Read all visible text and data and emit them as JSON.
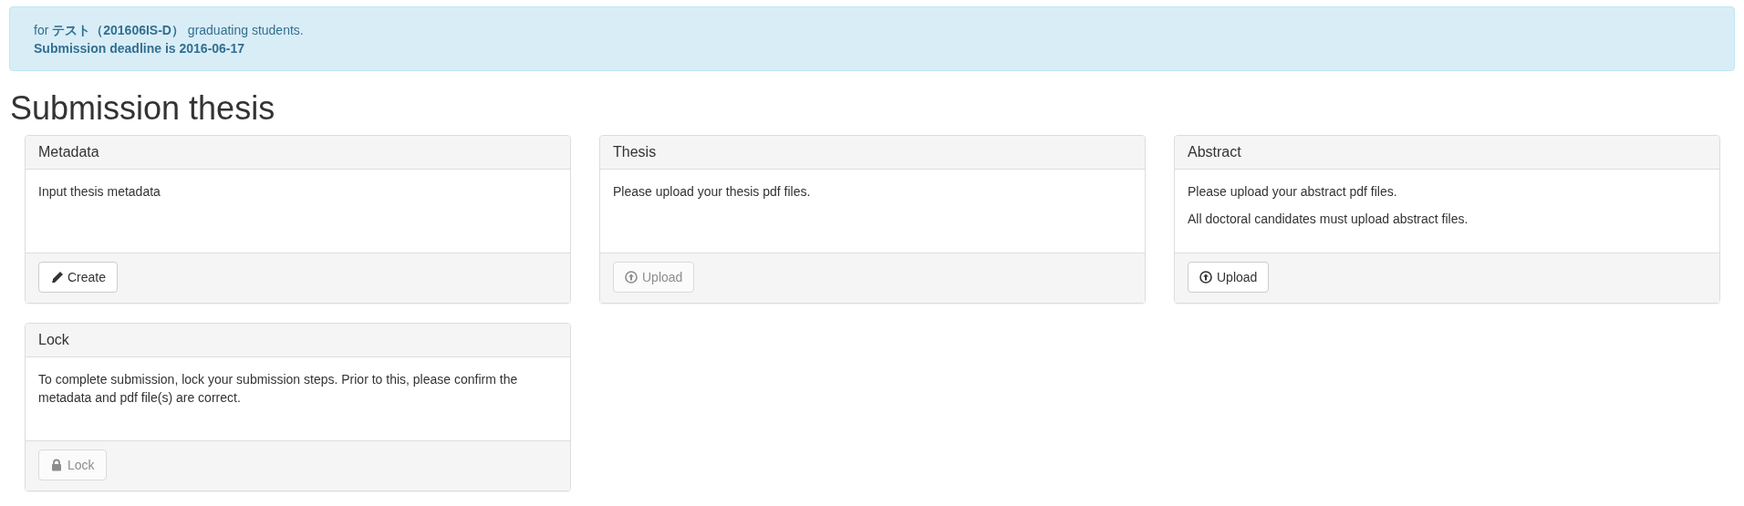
{
  "alert": {
    "lines": [
      {
        "text": "for **テスト（201606IS-D）** graduating students.",
        "bold": false
      },
      {
        "text": "Submission deadline is 2016-06-17",
        "bold": true
      }
    ]
  },
  "heading": "Submission thesis",
  "panels": [
    {
      "title": "Metadata",
      "paragraphs": [
        "Input thesis metadata"
      ],
      "button": {
        "label": "Create",
        "kind": "pencil",
        "disabled": false
      }
    },
    {
      "title": "Thesis",
      "paragraphs": [
        "Please upload your thesis pdf files."
      ],
      "button": {
        "label": "Upload",
        "kind": "upload",
        "disabled": true
      }
    },
    {
      "title": "Abstract",
      "paragraphs": [
        "Please upload your abstract pdf files.",
        "All doctoral candidates must upload abstract files."
      ],
      "button": {
        "label": "Upload",
        "kind": "upload",
        "disabled": false
      }
    },
    {
      "title": "Lock",
      "paragraphs": [
        "To complete submission, lock your submission steps. Prior to this, please confirm the metadata and pdf file(s) are correct."
      ],
      "button": {
        "label": "Lock",
        "kind": "lock",
        "disabled": true
      }
    }
  ]
}
